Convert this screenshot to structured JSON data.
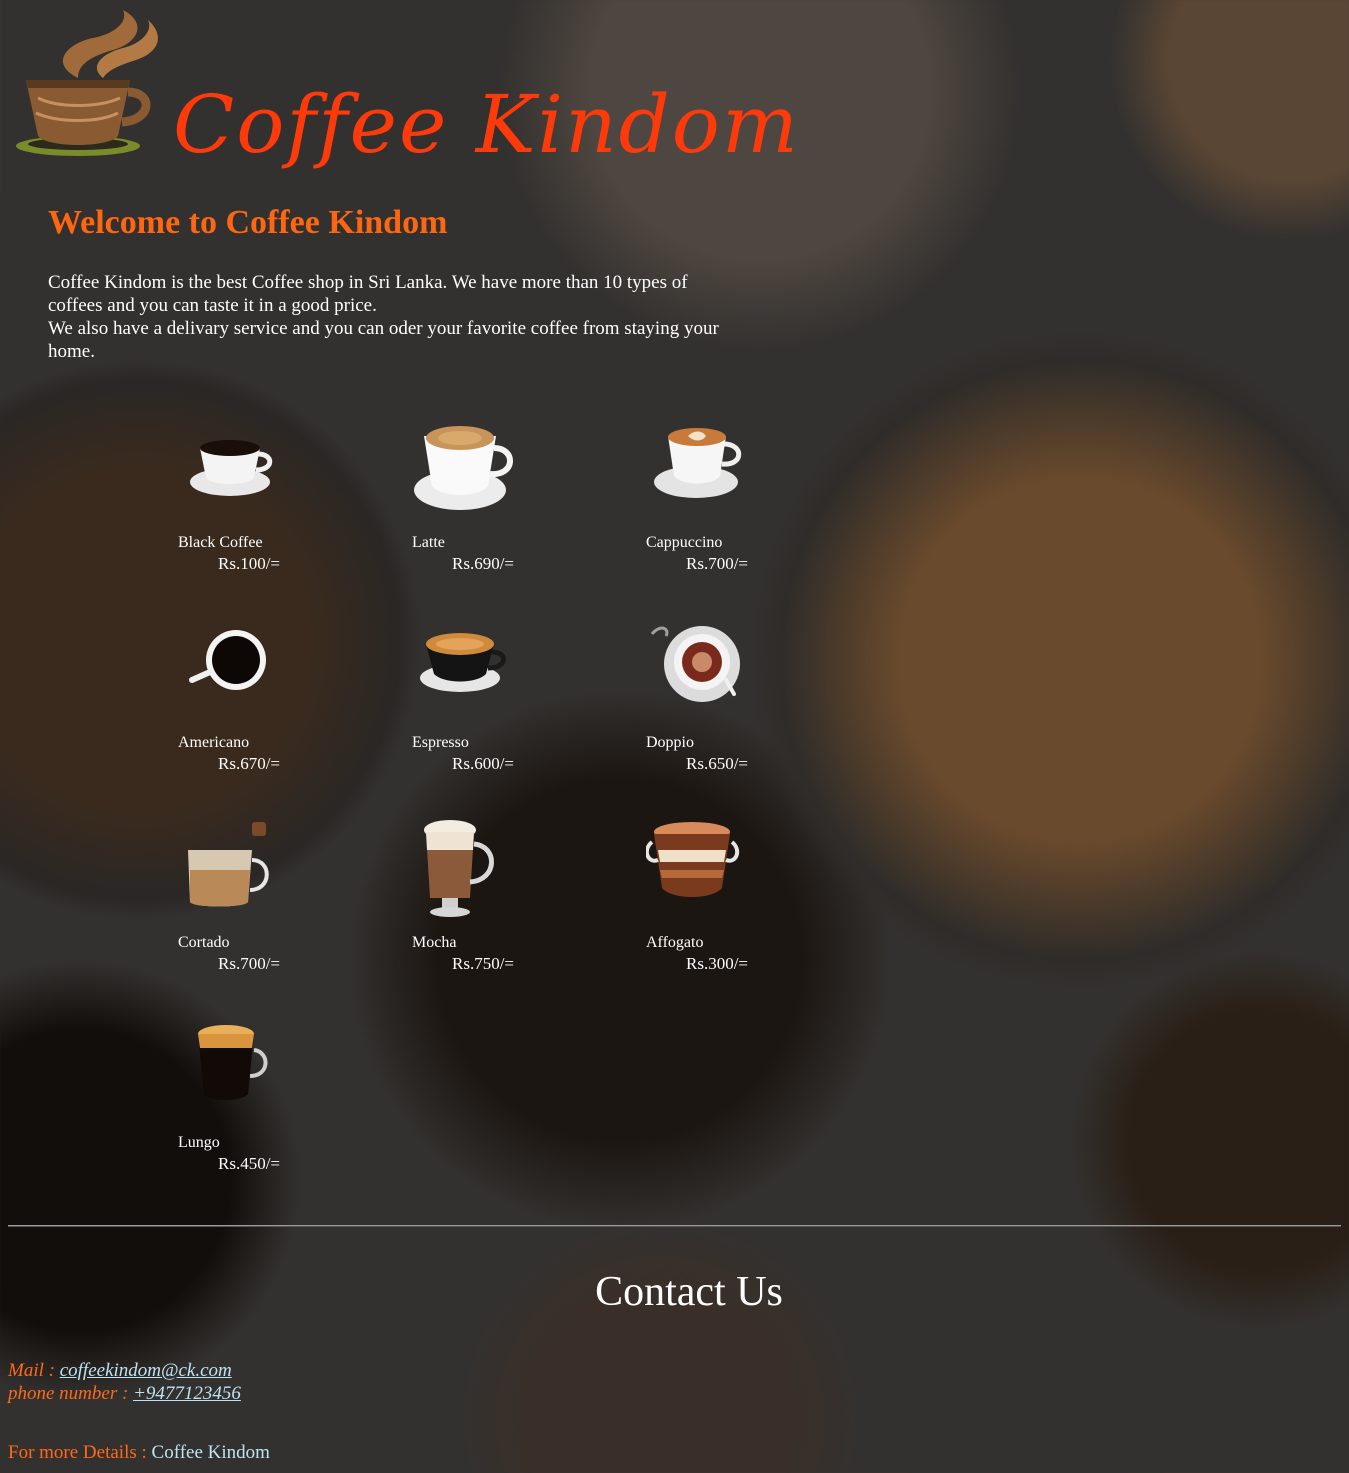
{
  "logo": {
    "text": "Coffee Kindom"
  },
  "welcome": {
    "heading": "Welcome to Coffee Kindom",
    "line1": "Coffee Kindom is the best Coffee shop in Sri Lanka. We have more than 10 types of coffees and you can taste it in a good price.",
    "line2": "We also have a delivary service and you can oder your favorite coffee from staying your home."
  },
  "menu": [
    {
      "name": "Black Coffee",
      "price": "Rs.100/=",
      "icon": "black-coffee-cup-icon"
    },
    {
      "name": "Latte",
      "price": "Rs.690/=",
      "icon": "latte-cup-icon"
    },
    {
      "name": "Cappuccino",
      "price": "Rs.700/=",
      "icon": "cappuccino-cup-icon"
    },
    {
      "name": "Americano",
      "price": "Rs.670/=",
      "icon": "americano-cup-icon"
    },
    {
      "name": "Espresso",
      "price": "Rs.600/=",
      "icon": "espresso-cup-icon"
    },
    {
      "name": "Doppio",
      "price": "Rs.650/=",
      "icon": "doppio-cup-icon"
    },
    {
      "name": "Cortado",
      "price": "Rs.700/=",
      "icon": "cortado-glass-icon"
    },
    {
      "name": "Mocha",
      "price": "Rs.750/=",
      "icon": "mocha-glass-icon"
    },
    {
      "name": "Affogato",
      "price": "Rs.300/=",
      "icon": "affogato-glass-icon"
    },
    {
      "name": "Lungo",
      "price": "Rs.450/=",
      "icon": "lungo-glass-icon"
    }
  ],
  "contact": {
    "title": "Contact Us",
    "mail_label": "Mail : ",
    "mail_value": "coffeekindom@ck.com ",
    "phone_label": "phone number : ",
    "phone_value": "+9477123456",
    "details_label": "For more Details : ",
    "details_link": "Coffee Kindom"
  },
  "colors": {
    "accent": "#ff6610",
    "logo": "#ff3a0a",
    "link": "#bfe3f2"
  }
}
